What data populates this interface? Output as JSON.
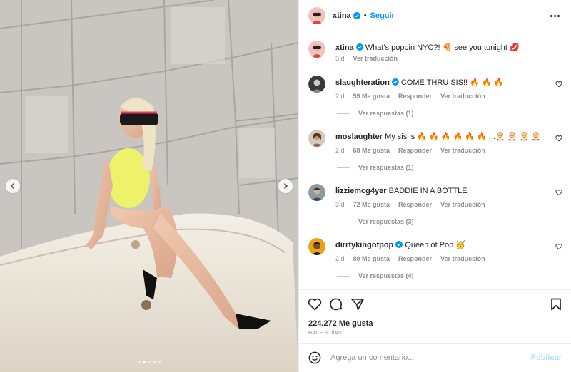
{
  "post": {
    "author": "xtina",
    "follow_label": "Seguir",
    "separator": "•"
  },
  "media": {
    "dots_count": 5,
    "active_dot": 1,
    "icons": [
      "chevron-left-icon",
      "chevron-right-icon"
    ]
  },
  "caption": {
    "username": "xtina",
    "text": "What's poppin NYC?! 🍕 see you tonight 💋",
    "age": "3 d",
    "translate": "Ver traducción"
  },
  "comments": [
    {
      "username": "slaughteration",
      "verified": true,
      "text": "COME THRU SIS!! 🔥 🔥 🔥",
      "age": "2 d",
      "likes": "59 Me gusta",
      "reply": "Responder",
      "translate": "Ver traducción",
      "replies": "Ver respuestas (1)"
    },
    {
      "username": "moslaughter",
      "verified": false,
      "text": "My sis is 🔥 🔥 🔥 🔥 🔥 🔥 ...🤶 🤶 🤶 🤶",
      "age": "2 d",
      "likes": "68 Me gusta",
      "reply": "Responder",
      "translate": "Ver traducción",
      "replies": "Ver respuestas (1)"
    },
    {
      "username": "lizziemcg4yer",
      "verified": false,
      "text": "BADDIE IN A BOTTLE",
      "age": "3 d",
      "likes": "72 Me gusta",
      "reply": "Responder",
      "translate": "Ver traducción",
      "replies": "Ver respuestas (3)"
    },
    {
      "username": "dirrtykingofpop",
      "verified": true,
      "text": "Queen of Pop 🥳",
      "age": "2 d",
      "likes": "80 Me gusta",
      "reply": "Responder",
      "translate": "Ver traducción",
      "replies": "Ver respuestas (4)"
    }
  ],
  "stats": {
    "likes": "224.272 Me gusta",
    "ago": "HACE 3 DÍAS"
  },
  "composer": {
    "placeholder": "Agrega un comentario...",
    "publish": "Publicar"
  },
  "colors": {
    "accent": "#0095f6",
    "muted": "#8e8e8e",
    "text": "#262626",
    "publish_disabled": "#b2dffc",
    "swimsuit": "#eef26a"
  }
}
